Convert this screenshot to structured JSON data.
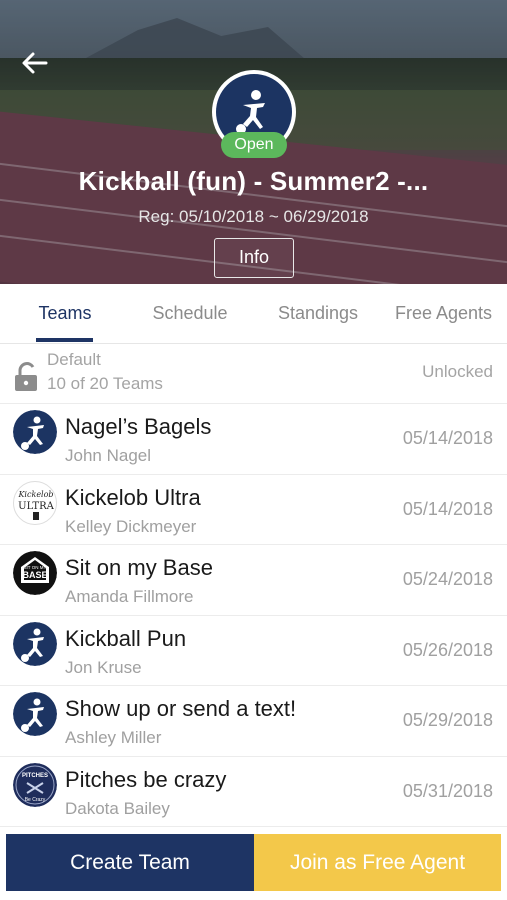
{
  "header": {
    "back_icon": "arrow-left-icon",
    "status_badge": "Open",
    "title": "Kickball (fun) - Summer2 -...",
    "reg_dates": "Reg: 05/10/2018 ~ 06/29/2018",
    "info_label": "Info"
  },
  "tabs": [
    {
      "label": "Teams",
      "active": true
    },
    {
      "label": "Schedule",
      "active": false
    },
    {
      "label": "Standings",
      "active": false
    },
    {
      "label": "Free Agents",
      "active": false
    }
  ],
  "division": {
    "icon": "lock-open-icon",
    "name": "Default",
    "count": "10 of 20 Teams",
    "status": "Unlocked"
  },
  "teams": [
    {
      "name": "Nagel’s Bagels",
      "captain": "John Nagel",
      "date": "05/14/2018",
      "avatar": "kickball-player-icon"
    },
    {
      "name": "Kickelob Ultra",
      "captain": "Kelley Dickmeyer",
      "date": "05/14/2018",
      "avatar": "kickelob-ultra-logo"
    },
    {
      "name": "Sit on my Base",
      "captain": "Amanda Fillmore",
      "date": "05/24/2018",
      "avatar": "base-logo"
    },
    {
      "name": "Kickball Pun",
      "captain": "Jon Kruse",
      "date": "05/26/2018",
      "avatar": "kickball-player-icon"
    },
    {
      "name": "Show up or send a text!",
      "captain": "Ashley Miller",
      "date": "05/29/2018",
      "avatar": "kickball-player-icon"
    },
    {
      "name": "Pitches be crazy",
      "captain": "Dakota Bailey",
      "date": "05/31/2018",
      "avatar": "pitches-logo"
    }
  ],
  "logo_text": {
    "kickelob": "Kickelob",
    "ultra": "ULTRA",
    "base": "BASE",
    "base_top": "SIT ON MY",
    "pitches": "PITCHES",
    "pitches_sub": "Be Crazy"
  },
  "actions": {
    "create_team": "Create Team",
    "join_free_agent": "Join as Free Agent"
  },
  "colors": {
    "primary": "#1e3464",
    "accent": "#f3c84a",
    "open_badge": "#5cb85c",
    "muted_text": "#a0a0a0"
  }
}
